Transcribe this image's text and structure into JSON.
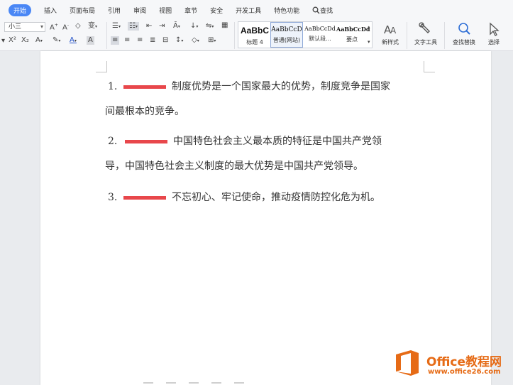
{
  "menubar": {
    "tabs": [
      "开始",
      "插入",
      "页面布局",
      "引用",
      "审阅",
      "视图",
      "章节",
      "安全",
      "开发工具",
      "特色功能"
    ],
    "search_label": "查找"
  },
  "ribbon": {
    "font_size_value": "小三",
    "styles": [
      {
        "preview": "AaBbC",
        "caption": "标题 4"
      },
      {
        "preview": "AaBbCcD",
        "caption": "普通(网站)"
      },
      {
        "preview": "AaBbCcDd",
        "caption": "默认段..."
      },
      {
        "preview": "AaBbCcDd",
        "caption": "要点"
      }
    ],
    "new_style_label": "新样式",
    "text_tools_label": "文字工具",
    "find_replace_label": "查找替换",
    "select_label": "选择"
  },
  "document": {
    "paragraphs": [
      {
        "number": "1.",
        "lines": [
          "制度优势是一个国家最大的优势，制度竞争是国家",
          "间最根本的竞争。"
        ]
      },
      {
        "number": "2.",
        "lines": [
          "中国特色社会主义最本质的特征是中国共产党领",
          "导，中国特色社会主义制度的最大优势是中国共产党领导。"
        ]
      },
      {
        "number": "3.",
        "lines": [
          "不忘初心、牢记使命，推动疫情防控化危为机。"
        ]
      }
    ],
    "blank_color": "#e8474b"
  },
  "watermark": {
    "title": "Office教程网",
    "url": "www.office26.com",
    "brand_color": "#e66b16"
  }
}
